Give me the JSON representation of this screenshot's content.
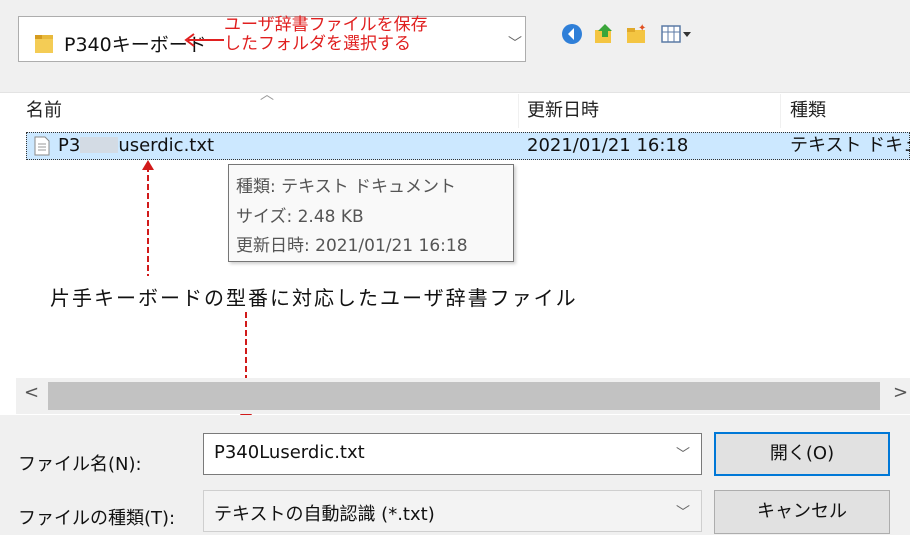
{
  "location": {
    "folder_name": "P340キーボード",
    "annotation": "ユーザ辞書ファイルを保存\nしたフォルダを選択する"
  },
  "toolbar": {
    "icons": [
      "back-icon",
      "up-folder-icon",
      "new-folder-icon",
      "view-menu-icon"
    ]
  },
  "columns": {
    "name": "名前",
    "modified": "更新日時",
    "type": "種類"
  },
  "files": [
    {
      "name_prefix": "P3",
      "name_suffix": "userdic.txt",
      "modified": "2021/01/21 16:18",
      "type": "テキスト ドキュ"
    }
  ],
  "tooltip": {
    "type": "種類: テキスト ドキュメント",
    "size": "サイズ: 2.48 KB",
    "modified": "更新日時: 2021/01/21 16:18"
  },
  "annotation_main": "片手キーボードの型番に対応したユーザ辞書ファイル",
  "scrollbar": {
    "left_arrow": "<",
    "right_arrow": ">"
  },
  "filename": {
    "label": "ファイル名(N):",
    "value": "P340Luserdic.txt"
  },
  "filetype": {
    "label": "ファイルの種類(T):",
    "value": "テキストの自動認識 (*.txt)"
  },
  "buttons": {
    "open": "開く(O)",
    "cancel": "キャンセル"
  },
  "colors": {
    "selection": "#cce8ff",
    "annotation_red": "#e02020",
    "default_button_border": "#0078d7"
  }
}
